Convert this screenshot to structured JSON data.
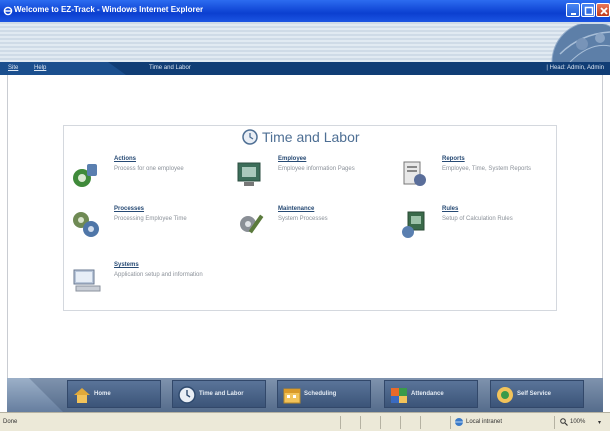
{
  "window": {
    "title": "Welcome to EZ-Track - Windows Internet Explorer",
    "icon": "ie-icon",
    "controls": [
      "minimize-icon",
      "maximize-icon",
      "close-icon"
    ]
  },
  "nav": {
    "links": [
      "Site",
      "Help"
    ],
    "section": "Time and Labor",
    "user": "| Head: Admin, Admin"
  },
  "panel": {
    "title": "Time and Labor",
    "icon": "clock-icon",
    "items": [
      {
        "name": "Actions",
        "desc": "Process for one employee",
        "icon": "actions-icon"
      },
      {
        "name": "Employee",
        "desc": "Employee information Pages",
        "icon": "employee-icon"
      },
      {
        "name": "Reports",
        "desc": "Employee, Time, System Reports",
        "icon": "reports-icon"
      },
      {
        "name": "Processes",
        "desc": "Processing Employee Time",
        "icon": "processes-icon"
      },
      {
        "name": "Maintenance",
        "desc": "System Processes",
        "icon": "maintenance-icon"
      },
      {
        "name": "Rules",
        "desc": "Setup of Calculation Rules",
        "icon": "rules-icon"
      },
      {
        "name": "Systems",
        "desc": "Application setup and information",
        "icon": "systems-icon"
      }
    ]
  },
  "toolbar": {
    "buttons": [
      {
        "label": "Home",
        "icon": "home-icon"
      },
      {
        "label": "Time and Labor",
        "icon": "clock-icon"
      },
      {
        "label": "Scheduling",
        "icon": "scheduling-icon"
      },
      {
        "label": "Attendance",
        "icon": "attendance-icon"
      },
      {
        "label": "Self Service",
        "icon": "self-service-icon"
      }
    ]
  },
  "status": {
    "text": "Done",
    "zone": "Local intranet",
    "zoom": "100%",
    "zoom_caret": "▾"
  },
  "colors": {
    "titlebar": "#0b3fd0",
    "navstrip": "#103d75",
    "panel_title": "#4e6f94",
    "toolbar": "#556c8c"
  }
}
